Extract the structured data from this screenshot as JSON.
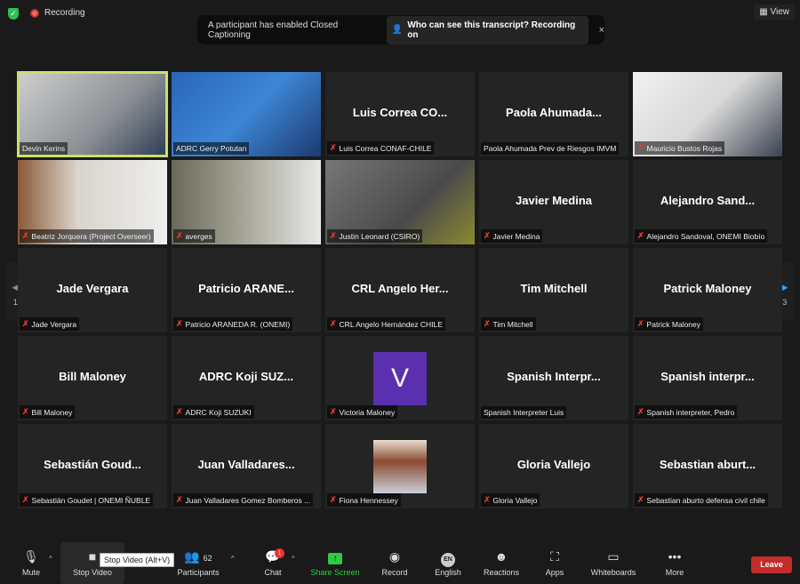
{
  "topbar": {
    "recording": "Recording",
    "view": "View",
    "view_icon": "grid-icon",
    "security_icon": "shield-icon"
  },
  "banner": {
    "message": "A participant has enabled Closed Captioning",
    "link": "Who can see this transcript? Recording on",
    "close": "×"
  },
  "pagination": {
    "left": "1/3",
    "right": "1/3",
    "accent": "#2da3ff"
  },
  "tiles": [
    {
      "label": "Devin Kerins",
      "type": "video",
      "muted": false,
      "active": true,
      "bg": "linear-gradient(135deg,#cfcfcf,#8a8e93 60%,#2c3a55)"
    },
    {
      "label": "ADRC Gerry Potutan",
      "type": "video",
      "muted": false,
      "bg": "linear-gradient(135deg,#2a66b8,#3d86d6 50%,#1c3a70)"
    },
    {
      "label": "Luis Correa CONAF-CHILE",
      "display": "Luis Correa CO...",
      "type": "name",
      "muted": true
    },
    {
      "label": "Paola Ahumada Prev de Riesgos IMVM",
      "display": "Paola Ahumada...",
      "type": "name",
      "muted": false
    },
    {
      "label": "Mauricio Bustos Rojas",
      "type": "video",
      "muted": true,
      "bg": "linear-gradient(135deg,#f2f2f2,#d8d8d8 50%,#3a4250)"
    },
    {
      "label": "Beatriz Jorquera (Project Overseer)",
      "type": "video",
      "muted": true,
      "bg": "linear-gradient(90deg,#8a5a36,#d9d5cc 40%,#eee)"
    },
    {
      "label": "averges",
      "type": "video",
      "muted": true,
      "bg": "linear-gradient(90deg,#6a6a5a,#a8a89a 50%,#e8e8e8)"
    },
    {
      "label": "Justin Leonard (CSIRO)",
      "type": "video",
      "muted": true,
      "bg": "linear-gradient(135deg,#777,#4a4a4a 60%,#8a8a30)"
    },
    {
      "label": "Javier Medina",
      "display": "Javier Medina",
      "type": "name",
      "muted": true
    },
    {
      "label": "Alejandro Sandoval, ONEMI Biobío",
      "display": "Alejandro  Sand...",
      "type": "name",
      "muted": true
    },
    {
      "label": "Jade Vergara",
      "display": "Jade Vergara",
      "type": "name",
      "muted": true
    },
    {
      "label": "Patricio ARANEDA R. (ONEMI)",
      "display": "Patricio  ARANE...",
      "type": "name",
      "muted": true
    },
    {
      "label": "CRL Angelo Hernández CHILE",
      "display": "CRL Angelo Her...",
      "type": "name",
      "muted": true
    },
    {
      "label": "Tim Mitchell",
      "display": "Tim Mitchell",
      "type": "name",
      "muted": true
    },
    {
      "label": "Patrick Maloney",
      "display": "Patrick Maloney",
      "type": "name",
      "muted": true
    },
    {
      "label": "Bill Maloney",
      "display": "Bill Maloney",
      "type": "name",
      "muted": true
    },
    {
      "label": "ADRC Koji SUZUKI",
      "display": "ADRC Koji SUZ...",
      "type": "name",
      "muted": true
    },
    {
      "label": "Victoria Maloney",
      "avatar_letter": "V",
      "avatar_color": "#5a2fb0",
      "type": "avatar",
      "muted": true
    },
    {
      "label": "Spanish Interpreter Luis",
      "display": "Spanish Interpr...",
      "type": "name",
      "muted": false
    },
    {
      "label": "Spanish interpreter, Pedro",
      "display": "Spanish interpr...",
      "type": "name",
      "muted": true
    },
    {
      "label": "Sebastián Goudet | ONEMI ÑUBLE",
      "display": "Sebastián Goud...",
      "type": "name",
      "muted": true
    },
    {
      "label": "Juan Valladares Gomez Bomberos ...",
      "display": "Juan Valladares...",
      "type": "name",
      "muted": true
    },
    {
      "label": "Fiona Hennessey",
      "type": "photo",
      "muted": true,
      "avatar_color": "linear-gradient(180deg,#e8ddd0,#8a4a30 40%,#c8d0d8)"
    },
    {
      "label": "Gloria Vallejo",
      "display": "Gloria Vallejo",
      "type": "name",
      "muted": true
    },
    {
      "label": "Sebastian aburto defensa civil chile",
      "display": "Sebastian aburt...",
      "type": "name",
      "muted": true
    }
  ],
  "toolbar": {
    "mute": "Mute",
    "stop_video": "Stop Video",
    "participants": "Participants",
    "participants_count": "62",
    "chat": "Chat",
    "chat_badge": "1",
    "share": "Share Screen",
    "record": "Record",
    "language": "English",
    "language_code": "EN",
    "reactions": "Reactions",
    "apps": "Apps",
    "whiteboards": "Whiteboards",
    "more": "More",
    "leave": "Leave",
    "tooltip": "Stop Video (Alt+V)",
    "share_color": "#2ecc40",
    "leave_color": "#c42b2b"
  }
}
